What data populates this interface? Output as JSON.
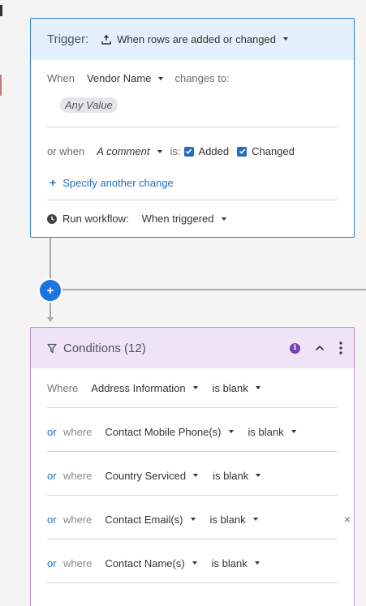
{
  "trigger": {
    "title": "Trigger:",
    "event": "When rows are added or changed",
    "when_label": "When",
    "field": "Vendor Name",
    "changes_to": "changes to:",
    "value_pill": "Any Value",
    "or_when": "or when",
    "comment": "A comment",
    "is_label": "is:",
    "added_label": "Added",
    "changed_label": "Changed",
    "specify_link": "Specify another change",
    "run_label": "Run workflow:",
    "run_value": "When triggered"
  },
  "conditions": {
    "title": "Conditions (12)",
    "rows": [
      {
        "prefix": "",
        "where": "Where",
        "field": "Address Information",
        "op": "is blank"
      },
      {
        "prefix": "or",
        "where": "where",
        "field": "Contact Mobile Phone(s)",
        "op": "is blank"
      },
      {
        "prefix": "or",
        "where": "where",
        "field": "Country Serviced",
        "op": "is blank"
      },
      {
        "prefix": "or",
        "where": "where",
        "field": "Contact Email(s)",
        "op": "is blank"
      },
      {
        "prefix": "or",
        "where": "where",
        "field": "Contact Name(s)",
        "op": "is blank"
      },
      {
        "prefix": "",
        "where": "",
        "field": "",
        "op": ""
      }
    ]
  },
  "colors": {
    "trigger_border": "#2f7fc1",
    "trigger_header": "#e3f0fb",
    "conditions_border": "#b38fd3",
    "conditions_header": "#efe4f6",
    "accent": "#1f6fc5",
    "add_button": "#1f73e0"
  },
  "icons": {
    "trigger_event": "upload-icon",
    "clock": "clock-icon",
    "filter": "filter-icon",
    "info": "info-icon",
    "collapse": "chevron-up-icon",
    "more": "more-vertical-icon",
    "remove": "close-icon",
    "add": "plus-icon"
  }
}
